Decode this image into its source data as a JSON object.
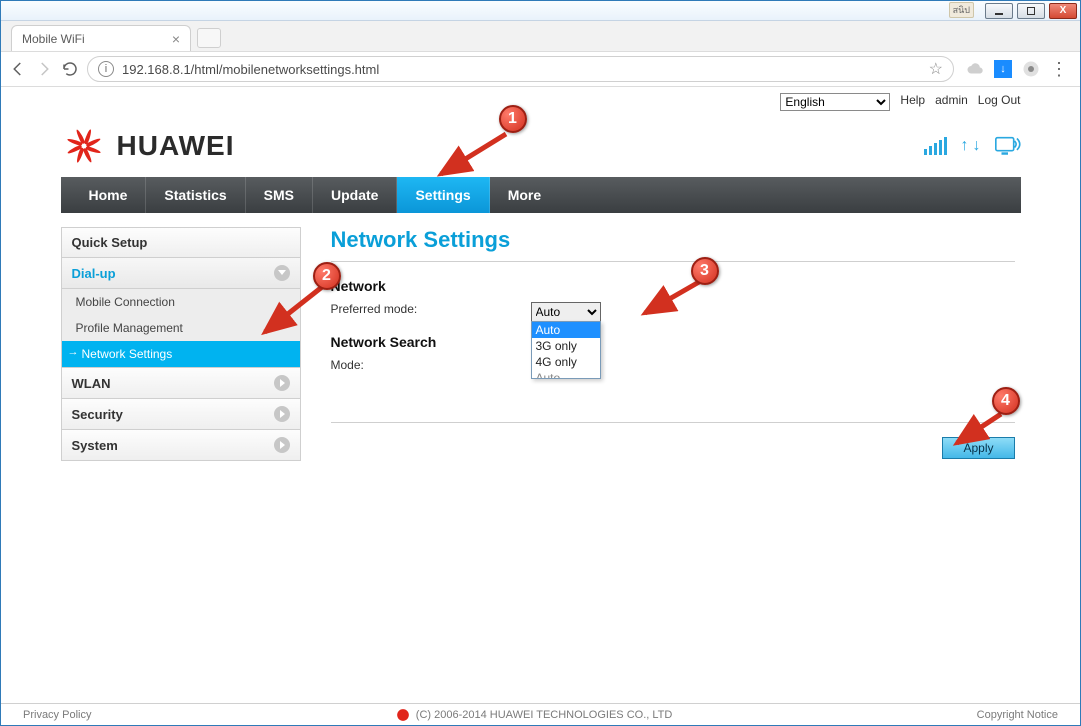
{
  "window": {
    "tab_title": "Mobile WiFi",
    "url": "192.168.8.1/html/mobilenetworksettings.html"
  },
  "header": {
    "language": "English",
    "help": "Help",
    "admin": "admin",
    "logout": "Log Out",
    "brand": "HUAWEI"
  },
  "nav": {
    "home": "Home",
    "statistics": "Statistics",
    "sms": "SMS",
    "update": "Update",
    "settings": "Settings",
    "more": "More"
  },
  "sidebar": {
    "quick_setup": "Quick Setup",
    "dialup": "Dial-up",
    "dialup_children": {
      "mobile_connection": "Mobile Connection",
      "profile_management": "Profile Management",
      "network_settings": "Network Settings"
    },
    "wlan": "WLAN",
    "security": "Security",
    "system": "System"
  },
  "content": {
    "title": "Network Settings",
    "network_heading": "Network",
    "preferred_mode_label": "Preferred mode:",
    "preferred_mode_value": "Auto",
    "options": {
      "auto": "Auto",
      "g3": "3G only",
      "g4": "4G only",
      "cut": "Auto"
    },
    "network_search_heading": "Network Search",
    "mode_label": "Mode:",
    "apply": "Apply"
  },
  "footer": {
    "privacy": "Privacy Policy",
    "copyright": "(C) 2006-2014 HUAWEI TECHNOLOGIES CO., LTD",
    "notice": "Copyright Notice"
  },
  "annotations": {
    "a1": "1",
    "a2": "2",
    "a3": "3",
    "a4": "4"
  }
}
